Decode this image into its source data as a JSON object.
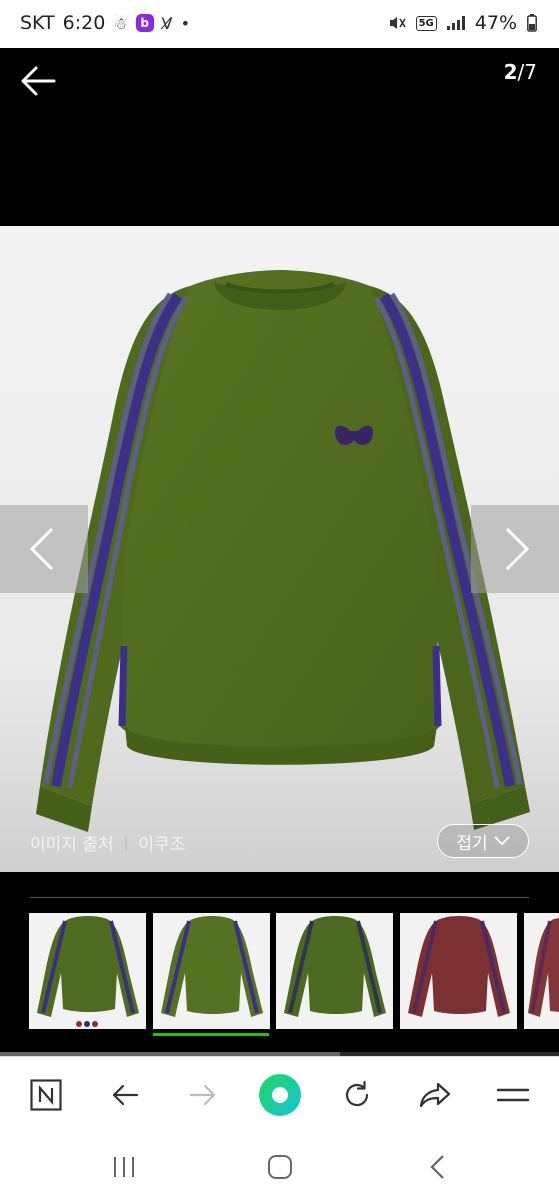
{
  "status_bar": {
    "carrier": "SKT",
    "time": "6:20",
    "network": "5G",
    "battery": "47%"
  },
  "viewer": {
    "page_current": "2",
    "page_total": "7",
    "image_source_label": "이미지 출처",
    "image_source_name": "이쿠조",
    "collapse_label": "접기"
  },
  "thumbnails": [
    {
      "color": "#4e6b1f",
      "stripe": "#3a2f7a"
    },
    {
      "color": "#557223",
      "stripe": "#3b2f85"
    },
    {
      "color": "#4b6a20",
      "stripe": "#2f3550"
    },
    {
      "color": "#7b3132",
      "stripe": "#4a2b5e"
    },
    {
      "color": "#83363a",
      "stripe": "#5a2b4e"
    }
  ],
  "colors": {
    "accent": "#1ec800",
    "sweater": "#546d1f",
    "stripe": "#3f2a8c"
  }
}
